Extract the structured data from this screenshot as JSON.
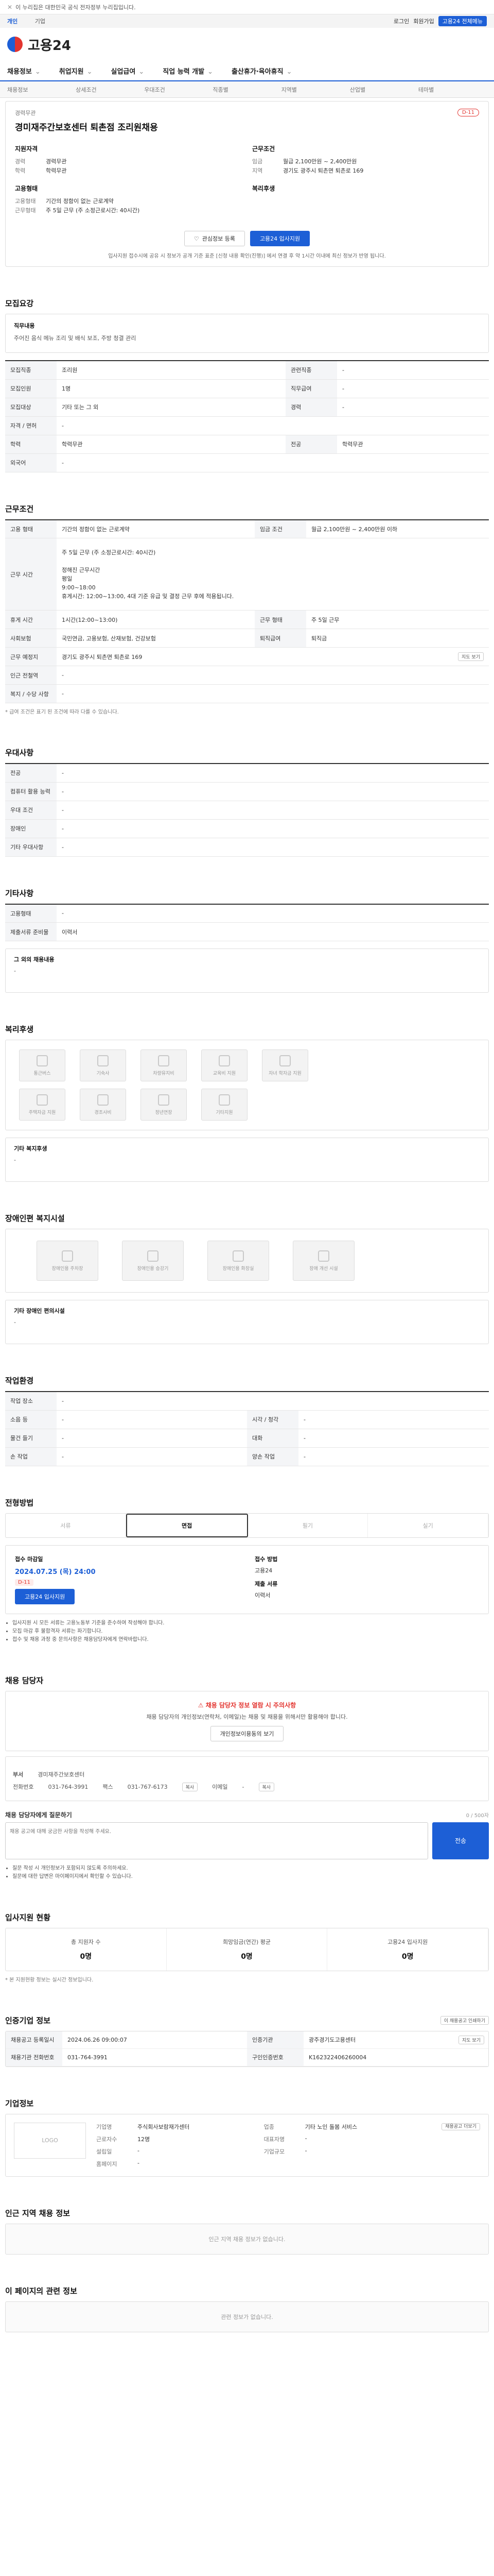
{
  "topbar": {
    "text": "이 누리집은 대한민국 공식 전자정부 누리집입니다."
  },
  "govbar": {
    "tabs": [
      "개인",
      "기업"
    ],
    "links": [
      "로그인",
      "회원가입"
    ],
    "pill": "고용24 전체메뉴"
  },
  "header": {
    "logo": "고용24"
  },
  "gnb": [
    "채용정보",
    "취업지원",
    "실업급여",
    "직업 능력 개발",
    "출산휴가·육아휴직"
  ],
  "subnav": [
    "채용정보",
    "상세조건",
    "우대조건",
    "직종별",
    "지역별",
    "산업별",
    "테마별"
  ],
  "summary": {
    "label": "경력무관",
    "title": "경미재주간보호센터 퇴촌점 조리원채용",
    "badge": "D-11",
    "company_head": "지원자격",
    "work_head": "근무조건",
    "company_rows": [
      {
        "k": "경력",
        "v": "경력무관"
      },
      {
        "k": "학력",
        "v": "학력무관"
      }
    ],
    "work_rows": [
      {
        "k": "임금",
        "v": "월급 2,100만원 ~ 2,400만원"
      },
      {
        "k": "지역",
        "v": "경기도 광주시 퇴촌면 퇴촌로 169"
      }
    ],
    "type_head": "고용형태",
    "type_rows": [
      {
        "k": "고용형태",
        "v": "기간의 정함이 없는 근로계약"
      },
      {
        "k": "근무형태",
        "v": "주 5일 근무 (주 소정근로시간: 40시간)"
      }
    ],
    "welfare_head": "복리후생",
    "btn_fav": "관심정보 등록",
    "btn_apply": "고용24 입사지원",
    "note": "입사지원 접수시에 공유 시 정보가 공개 기준 표준 [신청 내용 확인(진행)] 에서 연결 후 약 1시간 이내에 최신 정보가 반영 됩니다."
  },
  "sections": {
    "recruit": "모집요강",
    "conditions": "근무조건",
    "preference": "우대사항",
    "other": "기타사항",
    "welfare": "복리후생",
    "disability": "장애인편 복지시설",
    "environment": "작업환경",
    "process": "전형방법",
    "manager": "채용 담당자",
    "applicants": "입사지원 현황",
    "meta": "인증기업 정보",
    "companyinfo": "기업정보",
    "similar": "인근 지역 채용 정보",
    "recommended": "이 페이지의 관련 정보"
  },
  "recruit": {
    "work_title": "직무내용",
    "work_desc": "주어진 음식 메뉴 조리 및 배식 보조, 주방 청결 관리",
    "rows": [
      [
        {
          "k": "모집직종",
          "v": "조리원"
        },
        {
          "k": "관련직종",
          "v": "-"
        }
      ],
      [
        {
          "k": "모집인원",
          "v": "1명"
        },
        {
          "k": "직무급여",
          "v": "-"
        }
      ],
      [
        {
          "k": "모집대상",
          "v": "기타 또는 그 외"
        },
        {
          "k": "경력",
          "v": "-"
        }
      ],
      [
        {
          "k": "자격 / 면허",
          "v": "-"
        },
        {
          "k": "",
          "v": ""
        }
      ],
      [
        {
          "k": "학력",
          "v": "학력무관"
        },
        {
          "k": "전공",
          "v": "학력무관"
        }
      ],
      [
        {
          "k": "외국어",
          "v": "-"
        },
        {
          "k": "",
          "v": ""
        }
      ]
    ]
  },
  "conditions": {
    "rows": [
      [
        {
          "k": "고용 형태",
          "v": "기간의 정함이 없는 근로계약"
        },
        {
          "k": "임금 조건",
          "v": "월급 2,100만원 ~ 2,400만원 이하"
        }
      ],
      [
        {
          "k": "근무 시간",
          "v": "주 5일 근무 (주 소정근로시간: 40시간)\n\n정해진 근무시간\n평일\n9:00~18:00\n휴게시간: 12:00~13:00, 4대 기준 유급 및 결정 근무 후에 적용됩니다."
        },
        {
          "k": "",
          "v": ""
        }
      ],
      [
        {
          "k": "휴게 시간",
          "v": "1시간(12:00~13:00)"
        },
        {
          "k": "근무 형태",
          "v": "주 5일 근무"
        }
      ],
      [
        {
          "k": "사회보험",
          "v": "국민연금, 고용보험, 산재보험, 건강보험"
        },
        {
          "k": "퇴직급여",
          "v": "퇴직금"
        }
      ],
      [
        {
          "k": "근무 예정지",
          "v": "경기도 광주시 퇴촌면 퇴촌로 169"
        },
        {
          "k": "",
          "v": ""
        }
      ],
      [
        {
          "k": "인근 전철역",
          "v": "-"
        },
        {
          "k": "",
          "v": ""
        }
      ],
      [
        {
          "k": "복지 / 수당 사항",
          "v": "-"
        },
        {
          "k": "",
          "v": ""
        }
      ]
    ],
    "map_button": "지도 보기",
    "note": "* 급여 조건은 표기 된 조건에 따라 다를 수 있습니다."
  },
  "preference": {
    "rows": [
      {
        "k": "전공",
        "v": "-"
      },
      {
        "k": "컴퓨터 활용 능력",
        "v": "-"
      },
      {
        "k": "우대 조건",
        "v": "-"
      },
      {
        "k": "장애인",
        "v": "-"
      },
      {
        "k": "기타 우대사항",
        "v": "-"
      }
    ]
  },
  "other": {
    "rows": [
      {
        "k": "고용형태",
        "v": "-"
      },
      {
        "k": "제출서류 준비물",
        "v": "이력서"
      }
    ],
    "note_title": "그 외의 채용내용",
    "note_body": "-"
  },
  "welfare": {
    "row1": [
      "통근버스",
      "기숙사",
      "차량유지비",
      "교육비 지원",
      "자녀 학자금 지원"
    ],
    "row2": [
      "주택자금 지원",
      "경조사비",
      "정년연장",
      "기타지원"
    ],
    "subtitle": "기타 복지후생",
    "subbody": "-"
  },
  "disability": {
    "items": [
      "장애인용 주차장",
      "장애인용 승강기",
      "장애인용 화장실",
      "장애 개선 시설"
    ],
    "subtitle": "기타 장애인 편의시설",
    "subbody": "-"
  },
  "environment": {
    "rows": [
      [
        {
          "k": "작업 장소",
          "v": "-"
        },
        {
          "k": "",
          "v": ""
        }
      ],
      [
        {
          "k": "소음 등",
          "v": "-"
        },
        {
          "k": "시각 / 청각",
          "v": "-"
        }
      ],
      [
        {
          "k": "물건 들기",
          "v": "-"
        },
        {
          "k": "대화",
          "v": "-"
        }
      ],
      [
        {
          "k": "손 작업",
          "v": "-"
        },
        {
          "k": "양손 작업",
          "v": "-"
        }
      ]
    ]
  },
  "process": {
    "steps": [
      "서류",
      "면접",
      "필기",
      "실기"
    ],
    "active": 1,
    "deadline_label": "접수 마감일",
    "deadline": "2024.07.25 (목) 24:00",
    "dday": "D-11",
    "method_label": "접수 방법",
    "method": "고용24",
    "sub_label": "제출 서류",
    "sub_val": "이력서",
    "apply_btn": "고용24 입사지원",
    "notes": [
      "입사지원 시 모든 서류는 고용노동부 기준을 준수하여 작성해야 합니다.",
      "모집 마감 후 불합격자 서류는 파기합니다.",
      "접수 및 채용 과정 중 문의사항은 채용담당자에게 연락바랍니다."
    ]
  },
  "manager": {
    "warn_title": "채용 담당자 정보 열람 시 주의사항",
    "warn_body": "채용 담당자의 개인정보(연락처, 이메일)는 채용 및 채용을 위해서만 활용해야 합니다.",
    "warn_btn": "개인정보이용동의 보기",
    "dept_label": "부서",
    "dept": "경미재주간보호센터",
    "phone_label": "전화번호",
    "phone": "031-764-3991",
    "fax_label": "팩스",
    "fax": "031-767-6173",
    "email_label": "이메일",
    "email": "-",
    "copy_btn": "복사",
    "qa_label": "채용 담당자에게 질문하기",
    "qa_count": "0 / 500자",
    "qa_placeholder": "채용 공고에 대해 궁금한 사항을 작성해 주세요.",
    "qa_submit": "전송",
    "qa_notes": [
      "질문 작성 시 개인정보가 포함되지 않도록 주의하세요.",
      "질문에 대한 답변은 마이페이지에서 확인할 수 있습니다."
    ]
  },
  "applicants": {
    "cols": [
      {
        "k": "총 지원자 수",
        "v": "0명"
      },
      {
        "k": "희망임금(연간) 평균",
        "v": "0명"
      },
      {
        "k": "고용24 입사지원",
        "v": "0명"
      }
    ],
    "note": "* 본 지원현황 정보는 실시간 정보입니다."
  },
  "meta": {
    "rows_left": [
      {
        "k": "채용공고 등록일시",
        "v": "2024.06.26 09:00:07"
      },
      {
        "k": "채용기관 전화번호",
        "v": "031-764-3991"
      }
    ],
    "rows_right": [
      {
        "k": "인증기관",
        "v": "광주경기도고용센터"
      },
      {
        "k": "구인인증번호",
        "v": "K162322406260004"
      }
    ],
    "print_btn": "이 채용공고 인쇄하기",
    "map_btn": "지도 보기"
  },
  "companyinfo": {
    "logo": "LOGO",
    "name_label": "기업명",
    "name": "주식회사보람재가센터",
    "rows": [
      {
        "k": "업종",
        "v": "기타 노인 돌봄 서비스"
      },
      {
        "k": "근로자수",
        "v": "12명"
      },
      {
        "k": "대표자명",
        "v": "-"
      },
      {
        "k": "설립일",
        "v": "-"
      },
      {
        "k": "기업규모",
        "v": "-"
      },
      {
        "k": "홈페이지",
        "v": "-"
      }
    ],
    "detail_btn": "채용공고 더보기"
  },
  "similar": {
    "empty": "인근 지역 채용 정보가 없습니다."
  },
  "recommended": {
    "empty": "관련 정보가 없습니다."
  }
}
